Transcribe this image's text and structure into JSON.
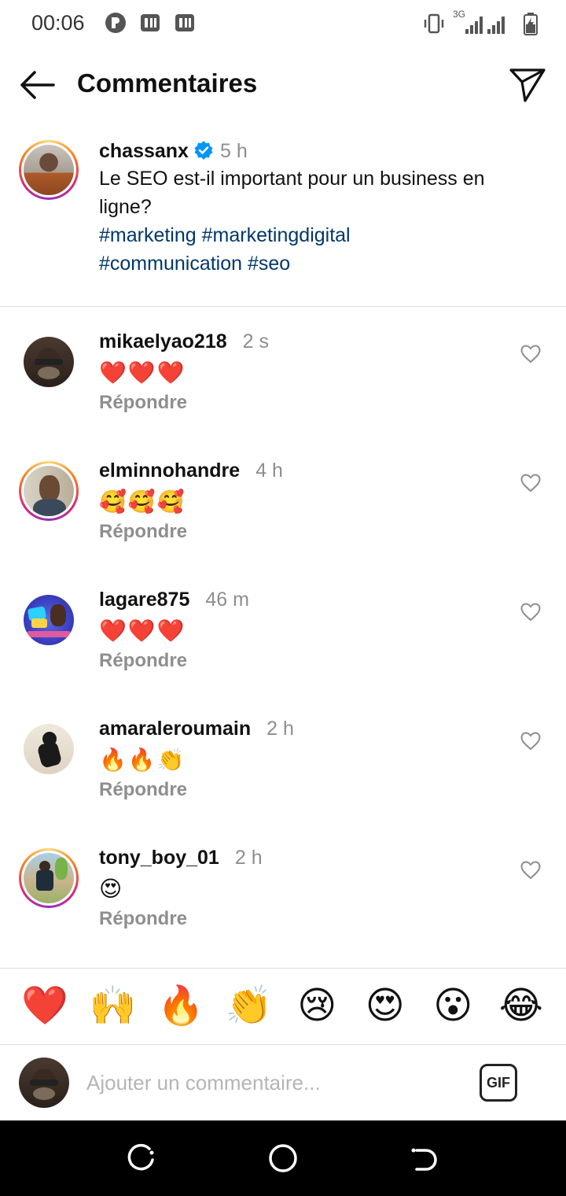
{
  "status_bar": {
    "time": "00:06",
    "network": "3G"
  },
  "header": {
    "title": "Commentaires"
  },
  "caption": {
    "username": "chassanx",
    "time": "5 h",
    "text": "Le SEO est-il important pour un business en ligne?",
    "hashtags_line1": "#marketing #marketingdigital",
    "hashtags_line2": "#communication #seo"
  },
  "comments": [
    {
      "username": "mikaelyao218",
      "time": "2 s",
      "text": "❤️❤️❤️",
      "reply": "Répondre"
    },
    {
      "username": "elminnohandre",
      "time": "4 h",
      "text": "🥰🥰🥰",
      "reply": "Répondre"
    },
    {
      "username": "lagare875",
      "time": "46 m",
      "text": "❤️❤️❤️",
      "reply": "Répondre"
    },
    {
      "username": "amaraleroumain",
      "time": "2 h",
      "text": "🔥🔥👏",
      "reply": "Répondre"
    },
    {
      "username": "tony_boy_01",
      "time": "2 h",
      "text": "😍",
      "reply": "Répondre"
    }
  ],
  "reactions": [
    "❤️",
    "🙌",
    "🔥",
    "👏",
    "😢",
    "😍",
    "😮",
    "😂"
  ],
  "composer": {
    "placeholder": "Ajouter un commentaire...",
    "gif_label": "GIF"
  },
  "colors": {
    "hashtag": "#00376b",
    "muted": "#8e8e8e",
    "verified": "#0095f6"
  }
}
